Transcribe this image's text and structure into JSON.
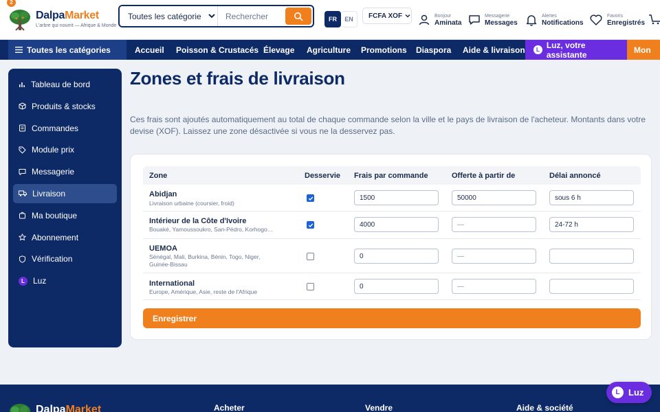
{
  "header": {
    "notif_count": "2",
    "brand_part1": "Dalpa",
    "brand_part2": "Market",
    "tagline": "L'arbre qui nourrit — Afrique & Monde",
    "search": {
      "category_selected": "Toutes les catégories",
      "placeholder": "Rechercher"
    },
    "lang_fr": "FR",
    "lang_en": "EN",
    "currency": "FCFA XOF",
    "account_small": "Bonjour",
    "account_name": "Aminata",
    "messages_small": "Messagerie",
    "messages_label": "Messages",
    "alerts_small": "Alertes",
    "alerts_label": "Notifications",
    "favs_small": "Favoris",
    "favs_label": "Enregistrés"
  },
  "nav": {
    "all_categories": "Toutes les catégories",
    "links": [
      "Accueil",
      "Poisson & Crustacés",
      "Élevage",
      "Agriculture",
      "Promotions",
      "Diaspora",
      "Aide & livraison"
    ],
    "luz_label": "Luz, votre assistante",
    "luz_initial": "L",
    "more_label": "Mon"
  },
  "sidebar": {
    "items": [
      {
        "label": "Tableau de bord",
        "icon": "bar-chart-icon"
      },
      {
        "label": "Produits & stocks",
        "icon": "box-icon"
      },
      {
        "label": "Commandes",
        "icon": "document-icon"
      },
      {
        "label": "Module prix",
        "icon": "tag-icon"
      },
      {
        "label": "Messagerie",
        "icon": "chat-icon"
      },
      {
        "label": "Livraison",
        "icon": "truck-icon",
        "active": true
      },
      {
        "label": "Ma boutique",
        "icon": "store-icon"
      },
      {
        "label": "Abonnement",
        "icon": "star-icon"
      },
      {
        "label": "Vérification",
        "icon": "shield-icon"
      },
      {
        "label": "Luz",
        "icon": "luz-avatar-icon"
      }
    ],
    "luz_initial": "L"
  },
  "main": {
    "title": "Zones et frais de livraison",
    "description": "Ces frais sont ajoutés automatiquement au total de chaque commande selon la ville et le pays de livraison de l'acheteur. Montants dans votre devise (XOF). Laissez une zone désactivée si vous ne la desservez pas.",
    "columns": [
      "Zone",
      "Desservie",
      "Frais par commande",
      "Offerte à partir de",
      "Délai annoncé"
    ],
    "zones": [
      {
        "name": "Abidjan",
        "sub": "Livraison urbaine (coursier, froid)",
        "served": true,
        "fee": "1500",
        "free_from": "50000",
        "free_placeholder": "",
        "delay": "sous 6 h"
      },
      {
        "name": "Intérieur de la Côte d'Ivoire",
        "sub": "Bouaké, Yamoussoukro, San-Pédro, Korhogo…",
        "served": true,
        "fee": "4000",
        "free_from": "",
        "free_placeholder": "—",
        "delay": "24-72 h"
      },
      {
        "name": "UEMOA",
        "sub": "Sénégal, Mali, Burkina, Bénin, Togo, Niger, Guinée-Bissau",
        "served": false,
        "fee": "0",
        "free_from": "",
        "free_placeholder": "—",
        "delay": ""
      },
      {
        "name": "International",
        "sub": "Europe, Amérique, Asie, reste de l'Afrique",
        "served": false,
        "fee": "0",
        "free_from": "",
        "free_placeholder": "—",
        "delay": ""
      }
    ],
    "save_label": "Enregistrer"
  },
  "footer": {
    "brand_part1": "Dalpa",
    "brand_part2": "Market",
    "columns": [
      "Acheter",
      "Vendre",
      "Aide & société"
    ]
  },
  "luz_button": {
    "initial": "L",
    "label": "Luz"
  },
  "colors": {
    "navy": "#0e2a66",
    "orange": "#f07f1e",
    "purple": "#6a2ee0",
    "blue_check": "#1d62d6"
  }
}
